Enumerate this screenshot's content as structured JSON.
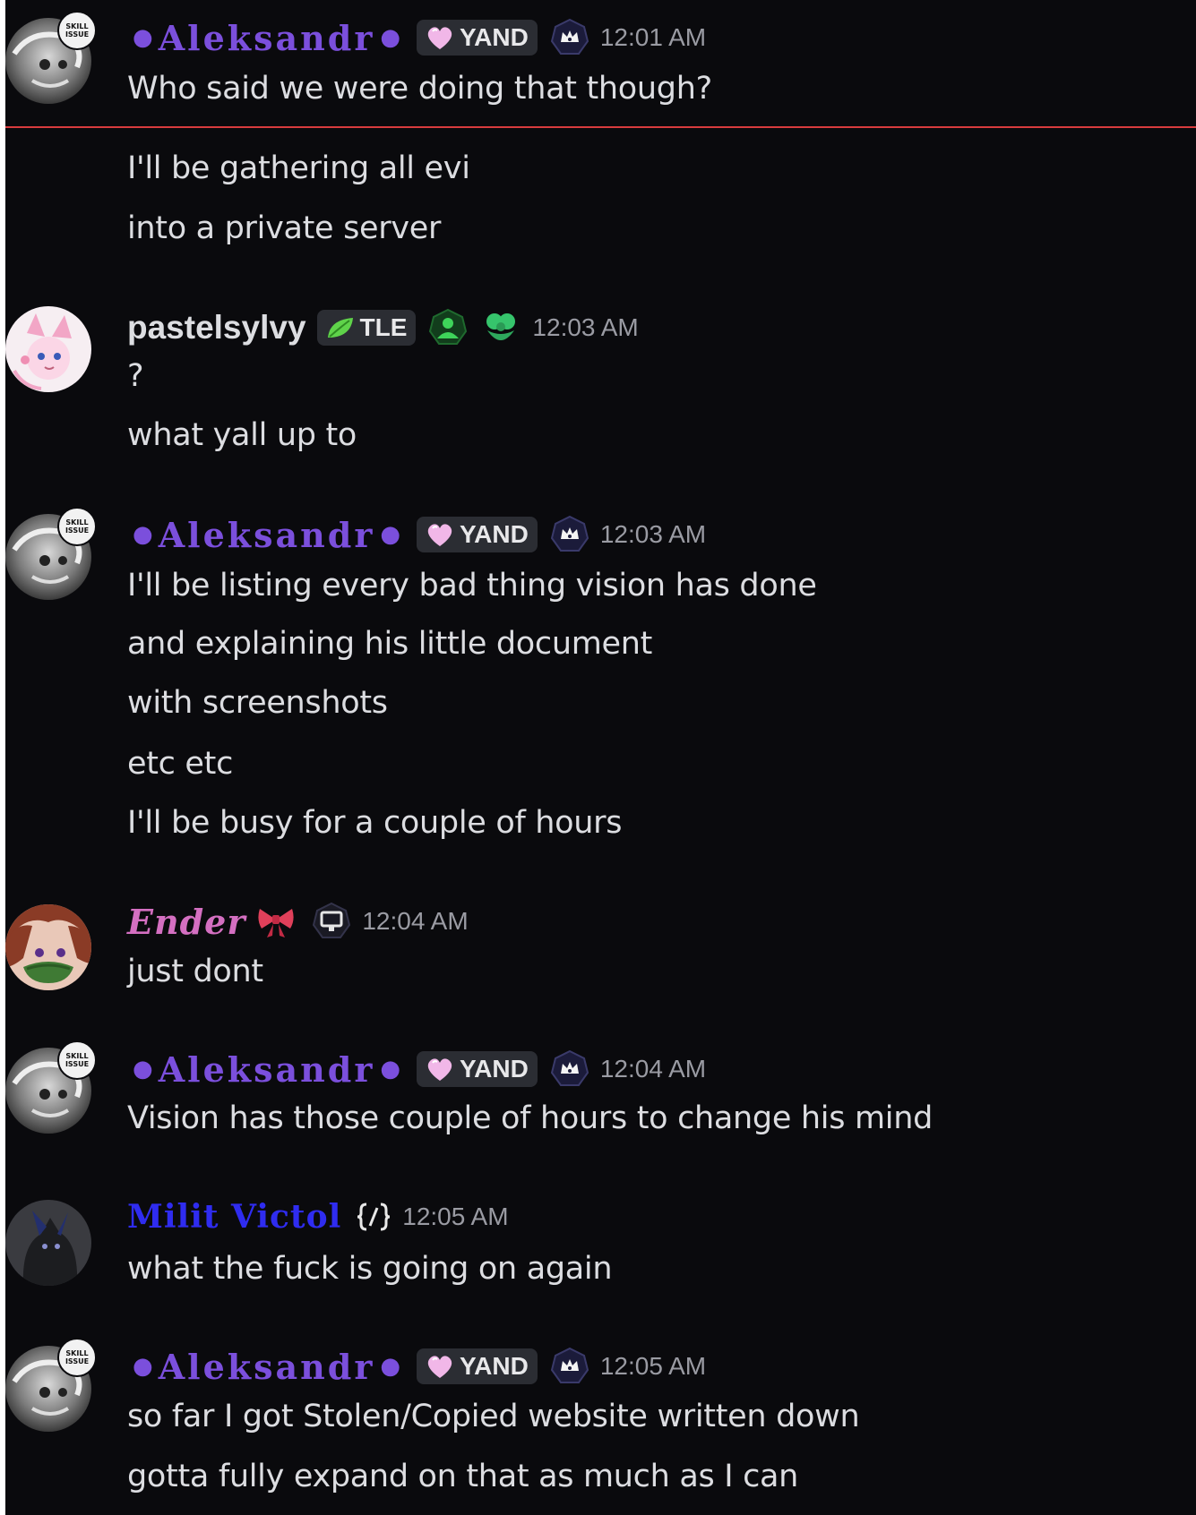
{
  "colors": {
    "background": "#0a0a0d",
    "aleksandr_name": "#7b4fdc",
    "ender_name": "#d46fc1",
    "milit_name": "#2f2cf0",
    "new_messages_divider": "#d83c3e",
    "timestamp": "#9a9ba3",
    "message_text": "#dcdde1"
  },
  "users": {
    "aleksandr": {
      "name": "Aleksandr",
      "tag": "YAND",
      "tag_icon": "heart-icon",
      "role_icon": "crown-shield-icon",
      "avatar_badge": "SKILL ISSUE"
    },
    "pastelsylvy": {
      "name": "pastelsylvy",
      "tag": "TLE",
      "tag_icon": "leaf-icon",
      "role_icons": [
        "person-icon",
        "flower-icon"
      ]
    },
    "ender": {
      "name": "Ender",
      "name_icon": "bow-icon",
      "role_icon": "monitor-icon"
    },
    "milit": {
      "name": "Milit Victol",
      "role_icon": "code-brackets-icon"
    }
  },
  "messages": [
    {
      "author": "Aleksandr",
      "time": "12:01 AM",
      "lines": [
        "Who said we were doing that though?"
      ]
    },
    {
      "continuation": true,
      "lines": [
        "I'll be gathering all evi",
        "into a private server"
      ]
    },
    {
      "author": "pastelsylvy",
      "time": "12:03 AM",
      "lines": [
        "?",
        "what yall up to"
      ]
    },
    {
      "author": "Aleksandr",
      "time": "12:03 AM",
      "lines": [
        "I'll be listing every bad thing vision has done",
        "and explaining his little document",
        "with screenshots",
        "etc etc",
        "I'll be busy for a couple of hours"
      ]
    },
    {
      "author": "Ender",
      "time": "12:04 AM",
      "lines": [
        "just dont"
      ]
    },
    {
      "author": "Aleksandr",
      "time": "12:04 AM",
      "lines": [
        "Vision has those couple of hours to change his mind"
      ]
    },
    {
      "author": "Milit Victol",
      "time": "12:05 AM",
      "lines": [
        "what the fuck is going on again"
      ]
    },
    {
      "author": "Aleksandr",
      "time": "12:05 AM",
      "lines": [
        "so far I got Stolen/Copied website written down",
        "gotta fully expand on that as much as I can"
      ]
    }
  ]
}
